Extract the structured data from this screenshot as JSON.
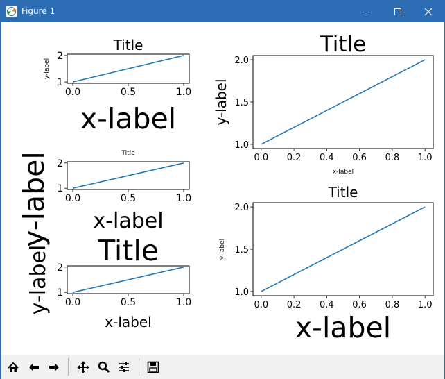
{
  "window": {
    "title": "Figure 1"
  },
  "colors": {
    "titlebar": "#2d6db4",
    "series": "#1f77b4",
    "toolbar_bg": "#f0f0f0"
  },
  "toolbar": {
    "buttons": [
      {
        "name": "home-button",
        "icon": "home-icon"
      },
      {
        "name": "back-button",
        "icon": "arrow-left-icon"
      },
      {
        "name": "forward-button",
        "icon": "arrow-right-icon"
      },
      {
        "name": "pan-button",
        "icon": "move-icon"
      },
      {
        "name": "zoom-button",
        "icon": "magnifier-icon"
      },
      {
        "name": "configure-subplots-button",
        "icon": "sliders-icon"
      },
      {
        "name": "save-button",
        "icon": "floppy-icon"
      }
    ]
  },
  "figure": {
    "left_ylabel": "y-label"
  },
  "chart_data": [
    {
      "type": "line",
      "title": "Title",
      "xlabel": "x-label",
      "ylabel": "y-label",
      "x": [
        0,
        1
      ],
      "series": [
        {
          "values": [
            1,
            2
          ]
        }
      ],
      "xticks": [
        "0.0",
        "0.5",
        "1.0"
      ],
      "yticks": [
        "1",
        "2"
      ],
      "xlim": [
        -0.05,
        1.05
      ],
      "ylim": [
        0.95,
        2.05
      ]
    },
    {
      "type": "line",
      "title": "Title",
      "xlabel": "x-label",
      "ylabel": "",
      "x": [
        0,
        1
      ],
      "series": [
        {
          "values": [
            1,
            2
          ]
        }
      ],
      "xticks": [
        "0.0",
        "0.5",
        "1.0"
      ],
      "yticks": [
        "1",
        "2"
      ],
      "xlim": [
        -0.05,
        1.05
      ],
      "ylim": [
        0.95,
        2.05
      ]
    },
    {
      "type": "line",
      "title": "Title",
      "xlabel": "x-label",
      "ylabel": "y-label",
      "x": [
        0,
        1
      ],
      "series": [
        {
          "values": [
            1,
            2
          ]
        }
      ],
      "xticks": [
        "0.0",
        "0.5",
        "1.0"
      ],
      "yticks": [
        "1",
        "2"
      ],
      "xlim": [
        -0.05,
        1.05
      ],
      "ylim": [
        0.95,
        2.05
      ]
    },
    {
      "type": "line",
      "title": "Title",
      "xlabel": "x-label",
      "ylabel": "y-label",
      "x": [
        0,
        1
      ],
      "series": [
        {
          "values": [
            1,
            2
          ]
        }
      ],
      "xticks": [
        "0.0",
        "0.2",
        "0.4",
        "0.6",
        "0.8",
        "1.0"
      ],
      "yticks": [
        "1.0",
        "1.5",
        "2.0"
      ],
      "xlim": [
        -0.05,
        1.05
      ],
      "ylim": [
        0.95,
        2.05
      ]
    },
    {
      "type": "line",
      "title": "Title",
      "xlabel": "x-label",
      "ylabel": "y-label",
      "x": [
        0,
        1
      ],
      "series": [
        {
          "values": [
            1,
            2
          ]
        }
      ],
      "xticks": [
        "0.0",
        "0.2",
        "0.4",
        "0.6",
        "0.8",
        "1.0"
      ],
      "yticks": [
        "1.0",
        "1.5",
        "2.0"
      ],
      "xlim": [
        -0.05,
        1.05
      ],
      "ylim": [
        0.95,
        2.05
      ]
    }
  ]
}
